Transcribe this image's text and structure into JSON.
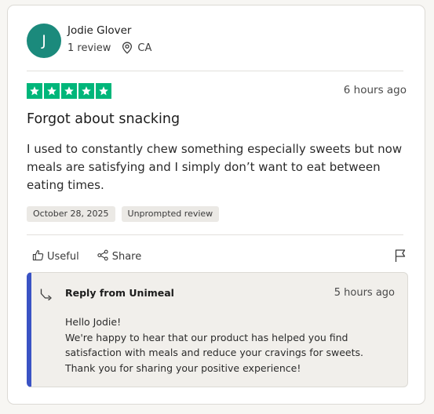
{
  "review": {
    "reviewer": {
      "initial": "J",
      "name": "Jodie Glover",
      "review_count": "1 review",
      "location": "CA",
      "avatar_color": "#1b8a7c"
    },
    "rating": 5,
    "rating_max": 5,
    "star_color": "#00b67a",
    "time_posted": "6 hours ago",
    "title": "Forgot about snacking",
    "body": "I used to constantly chew something especially sweets but now meals are satisfying and I simply don’t want to eat between eating times.",
    "date_chip": "October 28, 2025",
    "type_chip": "Unprompted review",
    "actions": {
      "useful_label": "Useful",
      "share_label": "Share"
    }
  },
  "reply": {
    "from": "Reply from Unimeal",
    "time": "5 hours ago",
    "accent_color": "#3a53c4",
    "lines": [
      "Hello Jodie!",
      "We're happy to hear that our product has helped you find",
      "satisfaction with meals and reduce your cravings for sweets.",
      "Thank you for sharing your positive experience!"
    ]
  }
}
